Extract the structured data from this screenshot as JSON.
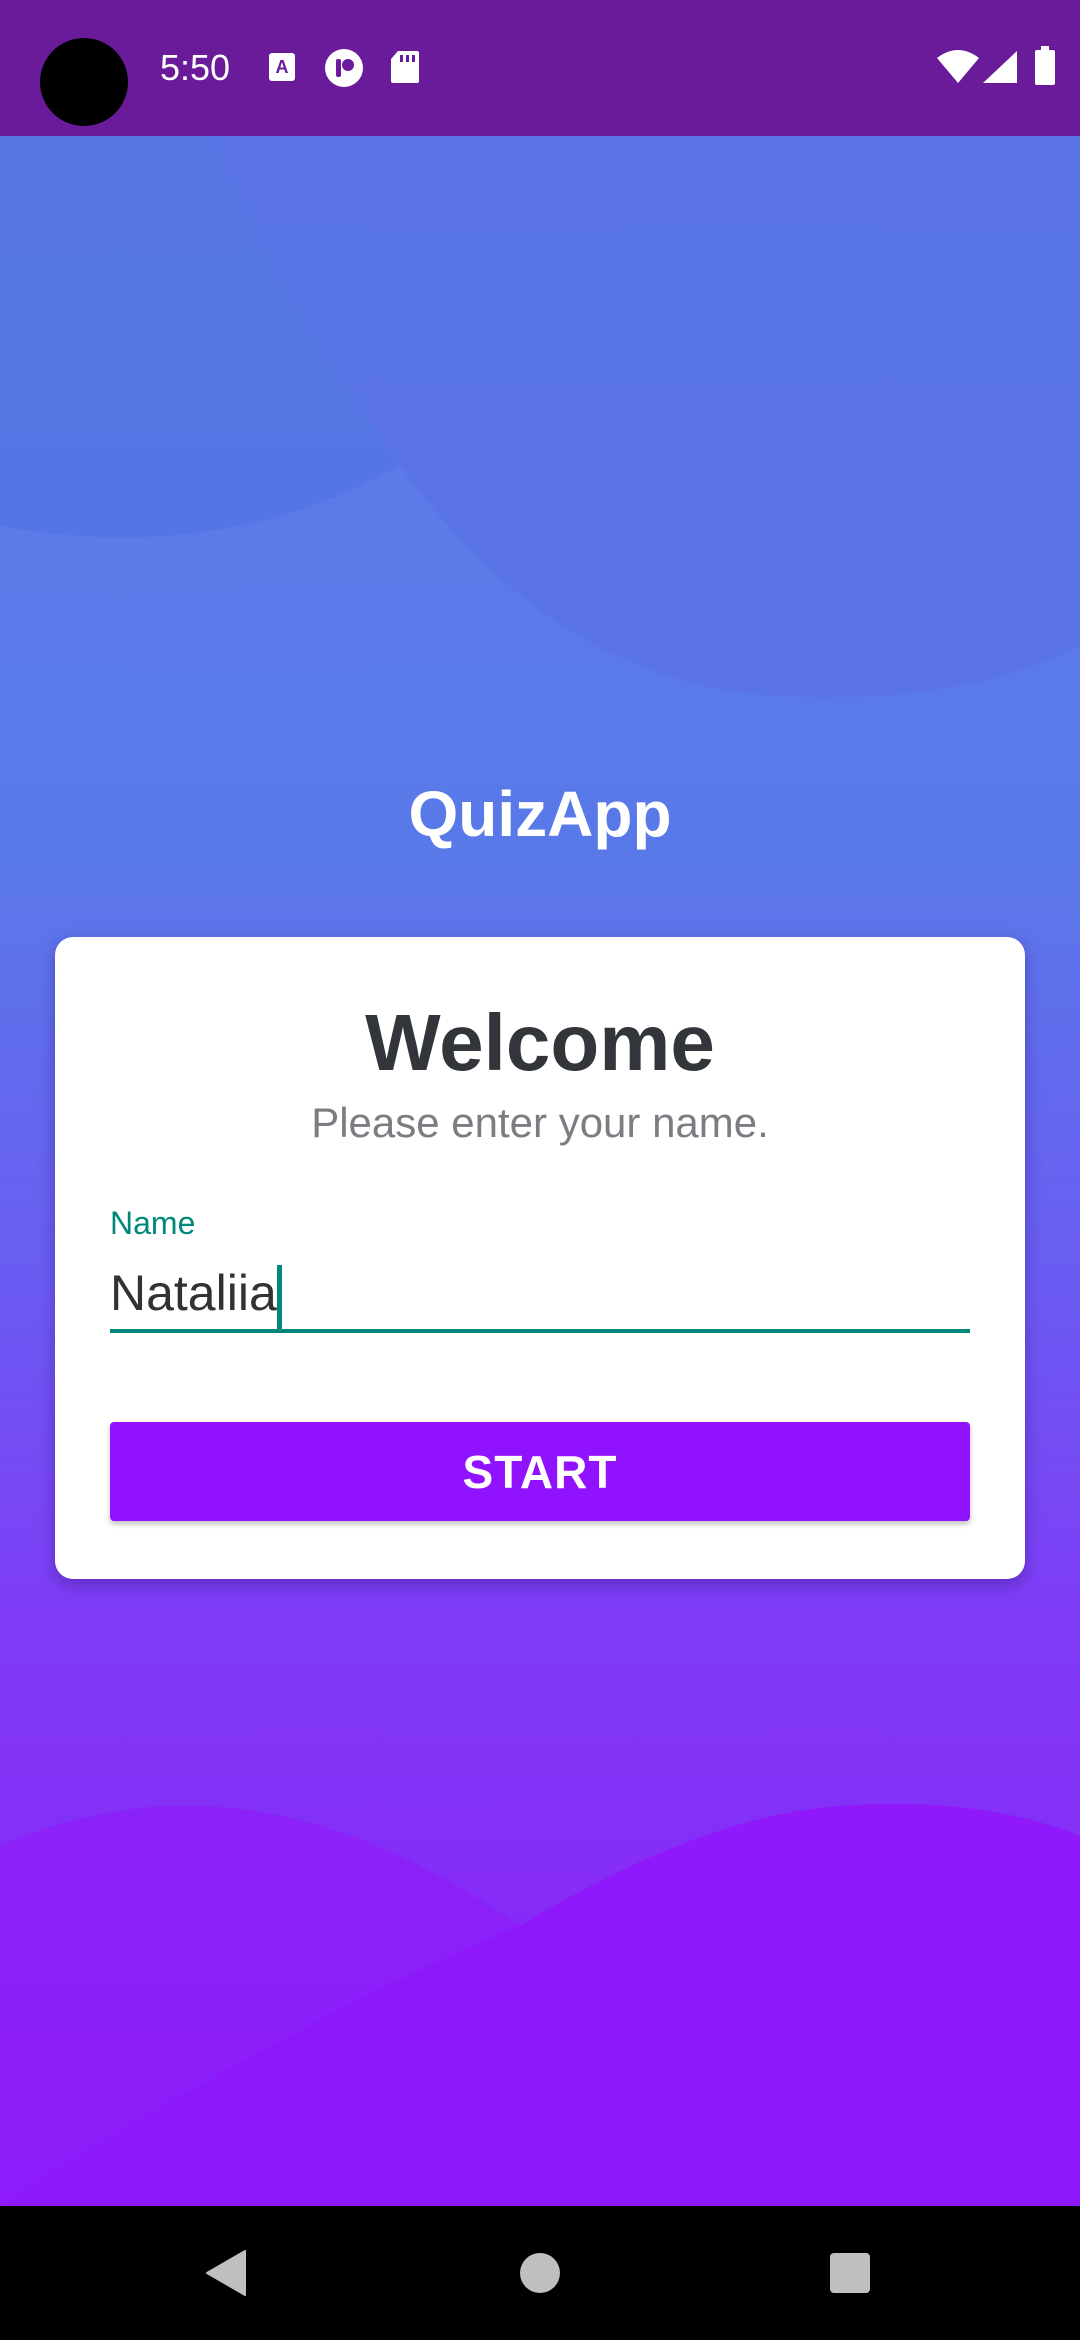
{
  "status_bar": {
    "time": "5:50",
    "background_color": "#6a1b9a",
    "left_icons": [
      "keyboard-a-icon",
      "app-logo-icon",
      "sd-card-icon"
    ],
    "right_icons": [
      "wifi-icon",
      "cellular-signal-icon",
      "battery-icon"
    ]
  },
  "app": {
    "title": "QuizApp",
    "gradient_top": "#5d7de8",
    "gradient_bottom": "#8c1bf8"
  },
  "card": {
    "heading": "Welcome",
    "subtitle": "Please enter your name.",
    "name_field": {
      "label": "Name",
      "value": "Nataliia",
      "accent_color": "#00897b"
    },
    "start_button": {
      "label": "START",
      "color": "#9012fe"
    }
  },
  "nav_bar": {
    "buttons": [
      "back-icon",
      "home-icon",
      "recents-icon"
    ]
  }
}
